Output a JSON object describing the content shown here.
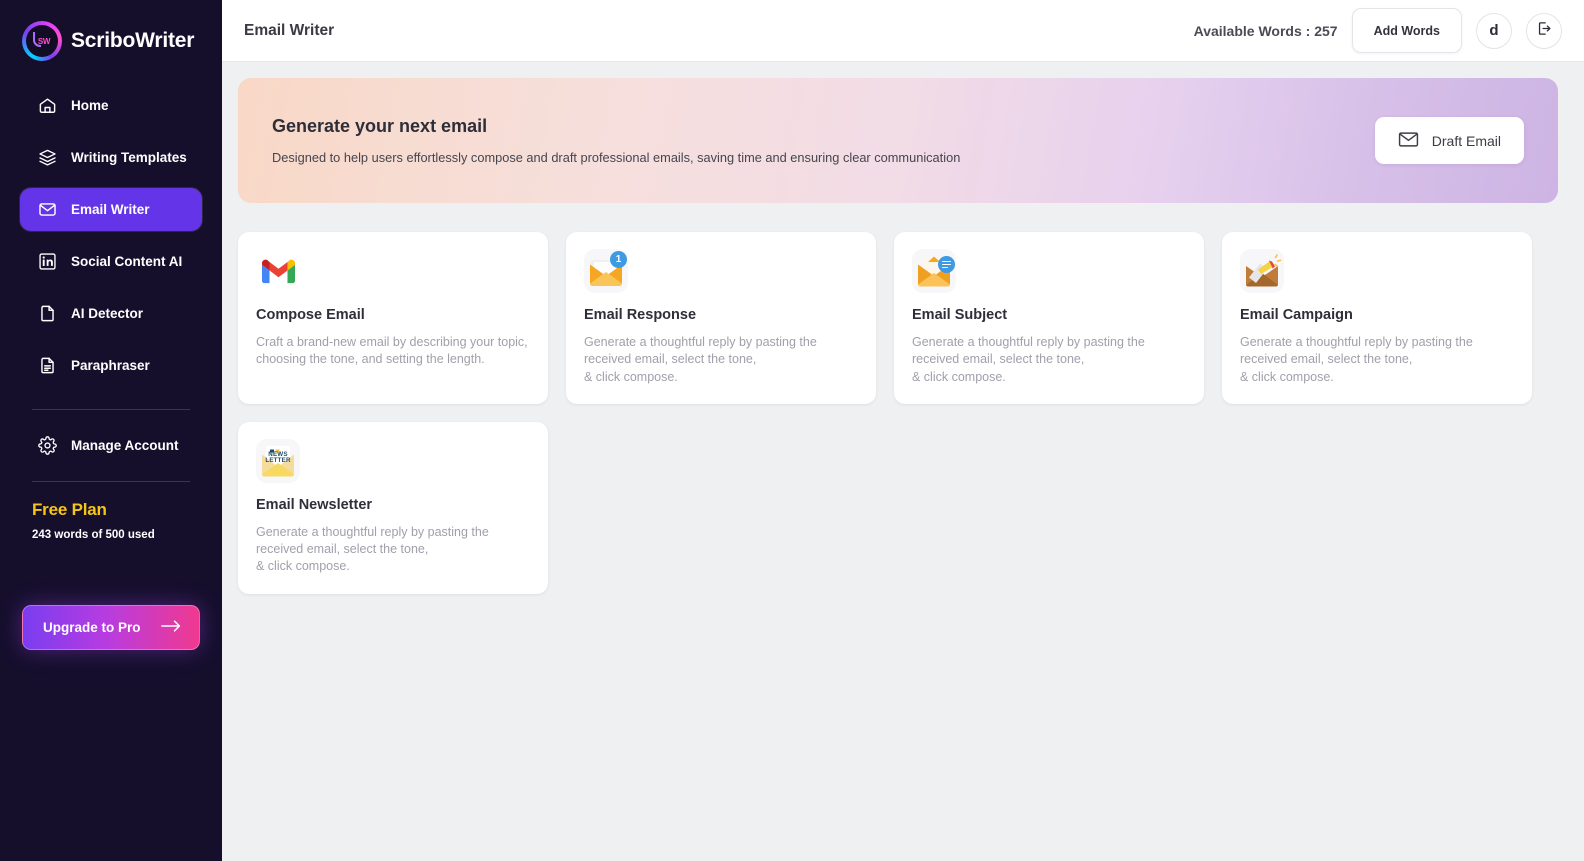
{
  "brand": {
    "name": "ScriboWriter",
    "mark_text": "SW"
  },
  "sidebar": {
    "items": [
      {
        "label": "Home",
        "icon": "home-icon",
        "active": false
      },
      {
        "label": "Writing Templates",
        "icon": "layers-icon",
        "active": false
      },
      {
        "label": "Email Writer",
        "icon": "envelope-icon",
        "active": true
      },
      {
        "label": "Social Content AI",
        "icon": "linkedin-icon",
        "active": false
      },
      {
        "label": "AI Detector",
        "icon": "document-icon",
        "active": false
      },
      {
        "label": "Paraphraser",
        "icon": "document-lines-icon",
        "active": false
      }
    ],
    "manage_account": {
      "label": "Manage Account",
      "icon": "gear-icon"
    },
    "plan": {
      "title": "Free Plan",
      "usage": "243 words of 500 used",
      "words_used": 243,
      "words_total": 500
    },
    "upgrade": {
      "label": "Upgrade to Pro",
      "icon": "arrow-right-icon"
    },
    "colors": {
      "background": "#150f2c",
      "active": "#6434e8",
      "plan_title": "#f5c518"
    }
  },
  "topbar": {
    "page_title": "Email Writer",
    "available_words_label": "Available Words : 257",
    "available_words": 257,
    "add_words_label": "Add Words",
    "avatar_initial": "d",
    "logout_icon": "logout-icon"
  },
  "banner": {
    "title": "Generate your next email",
    "subtitle": "Designed to help users effortlessly compose and draft professional emails, saving time and ensuring clear communication",
    "draft_button": {
      "label": "Draft Email",
      "icon": "envelope-icon"
    },
    "gradient_from": "#f9d8c6",
    "gradient_to": "#cdb4e4"
  },
  "cards": [
    {
      "title": "Compose Email",
      "description": "Craft a brand-new email by describing your topic, choosing the tone, and setting the length.",
      "icon": "gmail-icon"
    },
    {
      "title": "Email Response",
      "description": "Generate a thoughtful reply by pasting the received email, select the tone,\n& click compose.",
      "icon": "envelope-badge-1-icon",
      "badge": "1"
    },
    {
      "title": "Email Subject",
      "description": "Generate a thoughtful reply by pasting the received email, select the tone,\n& click compose.",
      "icon": "envelope-message-icon"
    },
    {
      "title": "Email Campaign",
      "description": "Generate a thoughtful reply by pasting the received email, select the tone,\n& click compose.",
      "icon": "envelope-megaphone-icon"
    },
    {
      "title": "Email Newsletter",
      "description": "Generate a thoughtful reply by pasting the received email, select the tone,\n& click compose.",
      "icon": "envelope-newsletter-icon",
      "icon_label": "NEWS\nLETTER"
    }
  ]
}
